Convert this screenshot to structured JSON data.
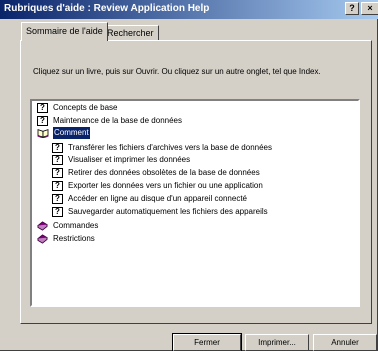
{
  "window": {
    "title": "Rubriques d'aide : Review Application Help",
    "help_button": "?",
    "close_button": "×"
  },
  "tabs": [
    {
      "label": "Sommaire de l'aide",
      "active": true
    },
    {
      "label": "Rechercher",
      "active": false
    }
  ],
  "instructions": "Cliquez sur un livre, puis sur Ouvrir. Ou cliquez sur un autre onglet, tel que Index.",
  "tree": {
    "items": [
      {
        "label": "Concepts de base",
        "icon": "help-page-icon",
        "level": 0
      },
      {
        "label": "Maintenance de la base de données",
        "icon": "help-page-icon",
        "level": 0
      },
      {
        "label": "Comment",
        "icon": "open-book-icon",
        "level": 0,
        "selected": true
      },
      {
        "label": "Transférer les fichiers d'archives vers la base de données",
        "icon": "help-page-icon",
        "level": 1
      },
      {
        "label": "Visualiser et imprimer les données",
        "icon": "help-page-icon",
        "level": 1
      },
      {
        "label": "Retirer des données obsolètes de la base de données",
        "icon": "help-page-icon",
        "level": 1
      },
      {
        "label": "Exporter les données vers un fichier ou une application",
        "icon": "help-page-icon",
        "level": 1
      },
      {
        "label": "Accéder en ligne au disque d'un appareil connecté",
        "icon": "help-page-icon",
        "level": 1
      },
      {
        "label": "Sauvegarder automatiquement les fichiers des appareils",
        "icon": "help-page-icon",
        "level": 1
      },
      {
        "label": "Commandes",
        "icon": "closed-book-icon",
        "level": 0
      },
      {
        "label": "Restrictions",
        "icon": "closed-book-icon",
        "level": 0
      }
    ]
  },
  "buttons": {
    "close": "Fermer",
    "print": "Imprimer...",
    "cancel": "Annuler"
  },
  "colors": {
    "title_gradient_start": "#0a246a",
    "title_gradient_end": "#a6caf0",
    "selection": "#0a246a",
    "book": "#800080",
    "face": "#d4d0c8"
  }
}
